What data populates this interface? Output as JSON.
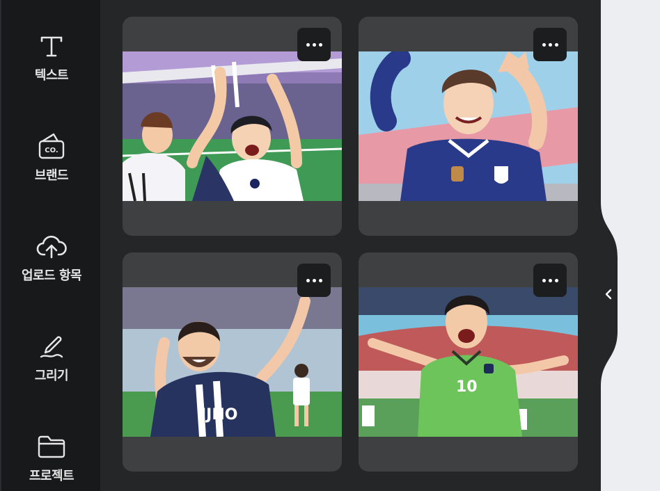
{
  "sidebar": {
    "items": [
      {
        "label": "텍스트",
        "icon": "text-icon"
      },
      {
        "label": "브랜드",
        "icon": "brand-icon"
      },
      {
        "label": "업로드 항목",
        "icon": "cloud-upload-icon"
      },
      {
        "label": "그리기",
        "icon": "draw-icon"
      },
      {
        "label": "프로젝트",
        "icon": "folder-icon"
      }
    ]
  },
  "gallery": {
    "cards": [
      {
        "image": "two-football-players-celebrating-illustration",
        "menu_icon": "more-icon"
      },
      {
        "image": "football-player-raising-arms-illustration",
        "menu_icon": "more-icon"
      },
      {
        "image": "bearded-player-pointing-up-illustration",
        "menu_icon": "more-icon"
      },
      {
        "image": "player-in-green-jersey-10-celebrating-illustration",
        "menu_icon": "more-icon"
      }
    ]
  },
  "collapse_panel": {
    "icon": "chevron-left-icon"
  },
  "colors": {
    "rail_bg": "#18191b",
    "panel_bg": "#252627",
    "card_bg": "#3f4042",
    "canvas_bg": "#eceef1"
  }
}
